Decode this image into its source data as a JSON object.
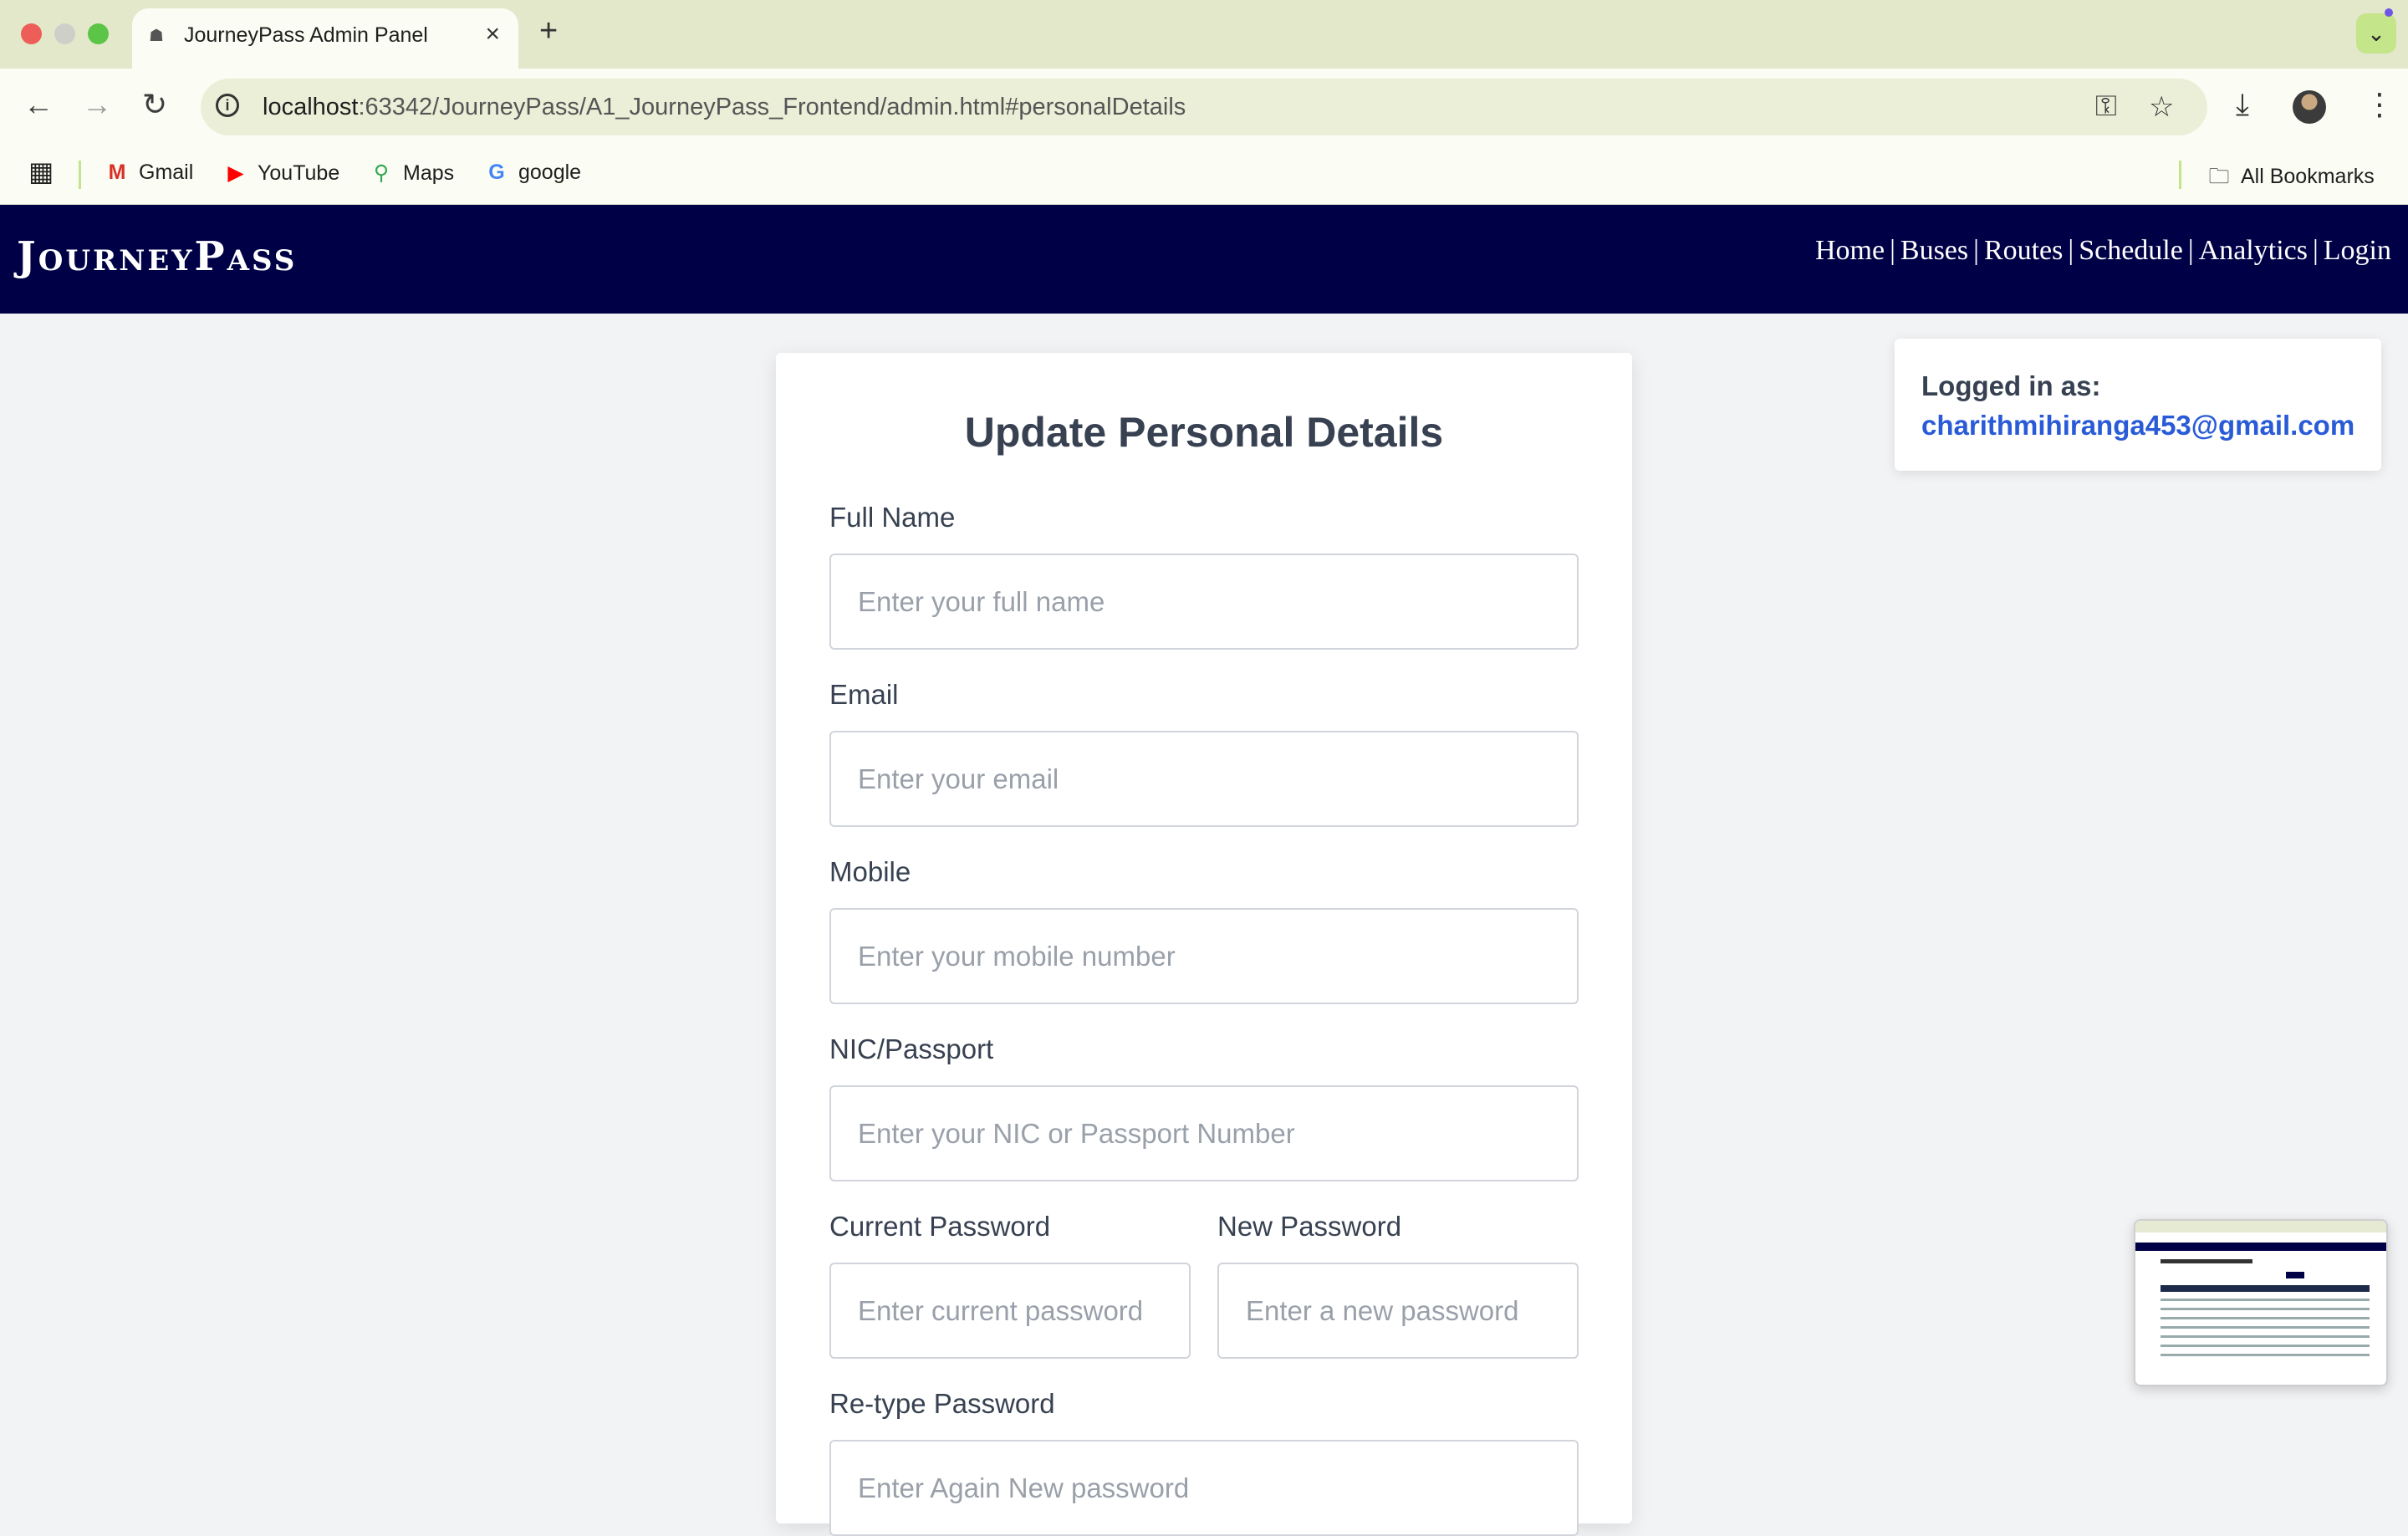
{
  "browser": {
    "tab_title": "JourneyPass Admin Panel",
    "url_host": "localhost",
    "url_rest": ":63342/JourneyPass/A1_JourneyPass_Frontend/admin.html#personalDetails",
    "bookmarks": [
      "Gmail",
      "YouTube",
      "Maps",
      "google"
    ],
    "all_bookmarks": "All Bookmarks"
  },
  "site": {
    "logo": "JourneyPass",
    "nav": [
      "Home",
      "Buses",
      "Routes",
      "Schedule",
      "Analytics",
      "Login"
    ],
    "nav_separator": "|"
  },
  "form": {
    "title": "Update Personal Details",
    "full_name_label": "Full Name",
    "full_name_placeholder": "Enter your full name",
    "email_label": "Email",
    "email_placeholder": "Enter your email",
    "mobile_label": "Mobile",
    "mobile_placeholder": "Enter your mobile number",
    "nic_label": "NIC/Passport",
    "nic_placeholder": "Enter your NIC or Passport Number",
    "current_password_label": "Current Password",
    "current_password_placeholder": "Enter current password",
    "new_password_label": "New Password",
    "new_password_placeholder": "Enter a new password",
    "retype_password_label": "Re-type Password",
    "retype_password_placeholder": "Enter Again New password"
  },
  "session": {
    "label": "Logged in as:",
    "email": "charithmihiranga453@gmail.com"
  },
  "colors": {
    "header_bg": "#000046",
    "accent_link": "#2a5bd7",
    "page_bg": "#f2f3f5"
  }
}
